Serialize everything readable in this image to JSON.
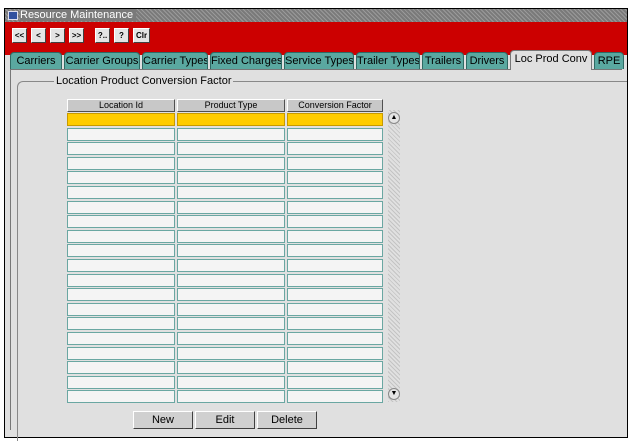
{
  "window": {
    "title": "Resource Maintenance"
  },
  "toolbar": {
    "buttons": [
      {
        "label": "<<",
        "name": "first-record-button"
      },
      {
        "label": "<",
        "name": "previous-record-button"
      },
      {
        "label": ">",
        "name": "next-record-button"
      },
      {
        "label": ">>",
        "name": "last-record-button"
      },
      {
        "label": "?..",
        "name": "query-button"
      },
      {
        "label": "?",
        "name": "help-button"
      },
      {
        "label": "Clr",
        "name": "clear-button"
      }
    ]
  },
  "tabs": [
    {
      "label": "Carriers"
    },
    {
      "label": "Carrier Groups"
    },
    {
      "label": "Carrier Types"
    },
    {
      "label": "Fixed Charges"
    },
    {
      "label": "Service Types"
    },
    {
      "label": "Trailer Types"
    },
    {
      "label": "Trailers"
    },
    {
      "label": "Drivers"
    },
    {
      "label": "Loc Prod Conv",
      "active": true
    },
    {
      "label": "RPE"
    }
  ],
  "panel": {
    "group_title": "Location Product Conversion Factor",
    "columns": [
      "Location Id",
      "Product Type",
      "Conversion Factor"
    ],
    "row_count": 20,
    "selected_row": 0
  },
  "buttons": {
    "new": "New",
    "edit": "Edit",
    "delete": "Delete"
  },
  "icons": {
    "window": "window-app-icon",
    "scroll_up": "scroll-up-arrow-icon",
    "scroll_down": "scroll-down-arrow-icon"
  }
}
